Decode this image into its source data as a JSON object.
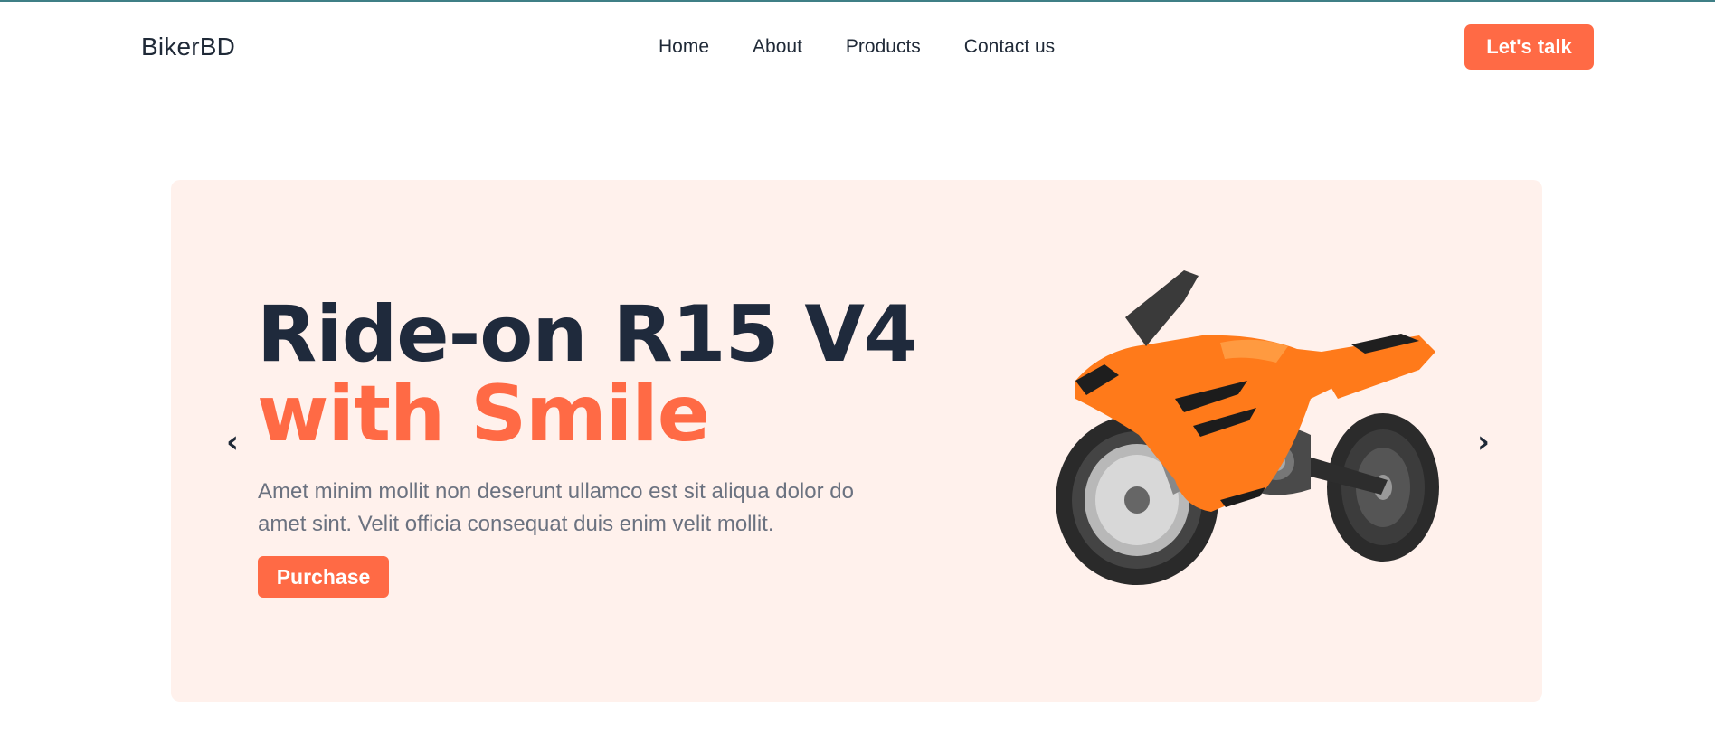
{
  "header": {
    "brand": "BikerBD",
    "nav": [
      {
        "label": "Home"
      },
      {
        "label": "About"
      },
      {
        "label": "Products"
      },
      {
        "label": "Contact us"
      }
    ],
    "cta_label": "Let's talk"
  },
  "hero": {
    "title_line1": "Ride-on R15 V4",
    "title_line2": "with Smile",
    "description": "Amet minim mollit non deserunt ullamco est sit aliqua dolor do amet sint. Velit officia consequat duis enim velit mollit.",
    "purchase_label": "Purchase",
    "prev_arrow": "‹",
    "next_arrow": "›",
    "image_icon": "motorcycle-image"
  },
  "colors": {
    "accent": "#ff6a45",
    "hero_bg": "#fff1ec",
    "title_dark": "#1f2a3c",
    "text_muted": "#6b7280"
  }
}
